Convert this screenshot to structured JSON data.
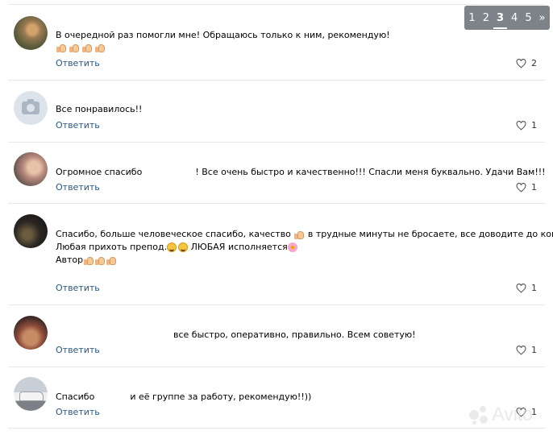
{
  "pagination": {
    "pages": [
      "1",
      "2",
      "3",
      "4",
      "5"
    ],
    "current": "3",
    "next_label": "»"
  },
  "comments": [
    {
      "text": "В очередной раз помогли мне! Обращаюсь только к ним, рекомендую!",
      "emoji": [
        "thumbs-up",
        "thumbs-up",
        "thumbs-up",
        "thumbs-up"
      ],
      "reply_label": "Ответить",
      "likes": "2"
    },
    {
      "text": "Все понравилось!!",
      "reply_label": "Ответить",
      "likes": "1"
    },
    {
      "text_before": "Огромное спасибо",
      "text_after": "! Все очень быстро и качественно!!! Спасли меня буквально. Удачи Вам!!!",
      "reply_label": "Ответить",
      "likes": "1"
    },
    {
      "line1_before": "Спасибо, больше человеческое спасибо, качество",
      "line1_after": "в трудные минуты не бросаете, все доводите до конца.",
      "line2_before": "Любая прихоть препод.",
      "line2_after": "ЛЮБАЯ исполняется",
      "line3": "Автор",
      "reply_label": "Ответить",
      "likes": "1"
    },
    {
      "text": "все быстро, оперативно, правильно. Всем советую!",
      "reply_label": "Ответить",
      "likes": "1"
    },
    {
      "text_before": "Спасибо",
      "text_after": "и её группе за работу, рекомендую!!))",
      "reply_label": "Ответить",
      "likes": "1"
    }
  ],
  "colors": {
    "link": "#2a5885",
    "divider": "#e6e8ec",
    "pager_bg": "#7d8388"
  },
  "watermark": "Avito"
}
